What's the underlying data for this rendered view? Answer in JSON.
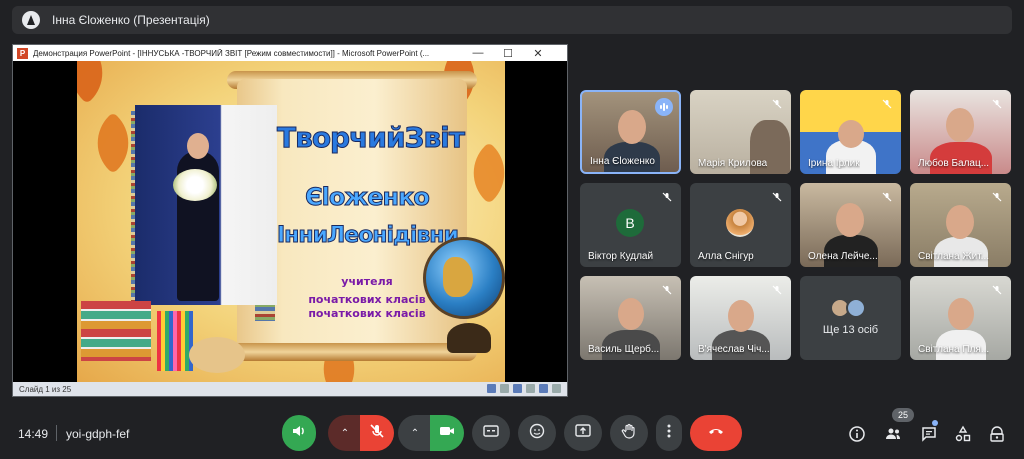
{
  "presenter_bar": {
    "title": "Інна Єloженко (Презентація)"
  },
  "ppt_window": {
    "title": "Демонстрация PowerPoint - [ІННУСЬКА -ТВОРЧИЙ ЗВІТ [Режим совместимости]] - Microsoft PowerPoint (...",
    "logo_letter": "P",
    "controls": {
      "minimize": "—",
      "maximize": "☐",
      "close": "✕"
    },
    "slide": {
      "line1": "ТворчийЗвіт",
      "line2": "Єloженко",
      "line3": "ІнниЛеонідівни",
      "line4": "учителя",
      "line5": "початкових класів",
      "line6": "початкових класів"
    },
    "status": {
      "slide_counter": "Слайд 1 из 25"
    }
  },
  "participants": [
    {
      "name": "Інна Єloженко",
      "active": true,
      "state": "speaking"
    },
    {
      "name": "Марія Крилова",
      "state": "muted"
    },
    {
      "name": "Ірина Ірлик",
      "state": "muted"
    },
    {
      "name": "Любов Балац...",
      "state": "muted"
    },
    {
      "name": "Віктор Кудлай",
      "state": "muted",
      "avatar_letter": "В"
    },
    {
      "name": "Алла Снігур",
      "state": "muted"
    },
    {
      "name": "Олена Лейче...",
      "state": "muted"
    },
    {
      "name": "Світлана Жит...",
      "state": "muted"
    },
    {
      "name": "Василь Щерб...",
      "state": "muted"
    },
    {
      "name": "В'ячеслав Чіч...",
      "state": "muted"
    },
    {
      "name": "Світлана Пля...",
      "state": "muted"
    }
  ],
  "more_tile": {
    "label": "Ще 13 осіб"
  },
  "bottom_bar": {
    "time": "14:49",
    "meeting_code": "yoi-gdph-fef",
    "people_count": "25"
  },
  "colors": {
    "accent": "#8ab4f8",
    "green": "#34a853",
    "red": "#ea4335",
    "bg": "#202124"
  }
}
